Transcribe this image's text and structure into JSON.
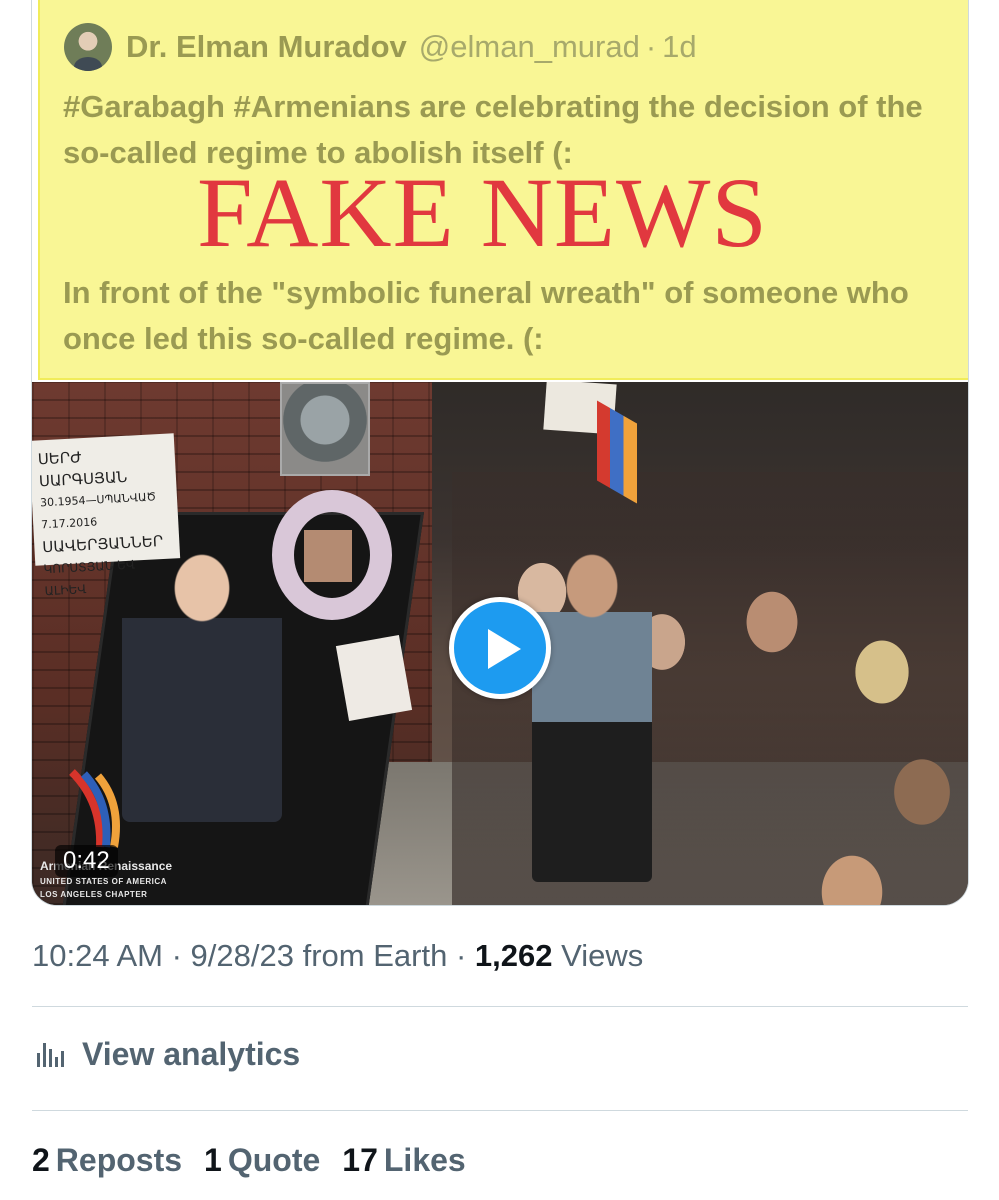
{
  "quoted_tweet": {
    "author_name": "Dr. Elman Muradov",
    "author_handle": "@elman_murad",
    "separator": "·",
    "time_ago": "1d",
    "text_paragraph_1": "#Garabagh #Armenians are celebrating the decision of the so-called regime to abolish itself (:",
    "text_paragraph_2": "In front of the \"symbolic funeral wreath\" of someone who once led this so-called regime. (:",
    "overlay_stamp": "FAKE NEWS",
    "highlight_color": "#f9f695",
    "stamp_color": "#e1383f"
  },
  "video": {
    "duration": "0:42",
    "play_icon": "play-icon",
    "sign_text_lines": [
      "ՍԵՐԺ ՍԱՐԳՍՅԱՆ",
      "30.1954—ՍՊԱՆՎԱԾ 7.17.2016",
      "ՍԱՎԵՐՅԱՆՆԵՐ",
      "ԿՈՐՍՏՅԱՆ ԵՎ ԱԼԻԵՎ"
    ],
    "watermark_line_1": "Armenian Renaissance",
    "watermark_line_2": "UNITED STATES OF AMERICA",
    "watermark_line_3": "LOS ANGELES CHAPTER"
  },
  "meta": {
    "time": "10:24 AM",
    "date": "9/28/23",
    "source": "from Earth",
    "sep1": " · ",
    "sep2": " · ",
    "views_count": "1,262",
    "views_label": "Views"
  },
  "analytics": {
    "icon": "bar-chart-icon",
    "label": "View analytics"
  },
  "stats": {
    "reposts_count": "2",
    "reposts_label": "Reposts",
    "quotes_count": "1",
    "quotes_label": "Quote",
    "likes_count": "17",
    "likes_label": "Likes"
  },
  "colors": {
    "secondary_text": "#536471",
    "primary_text": "#0f1419",
    "accent": "#1d9bf0",
    "border": "#cfd9de"
  }
}
